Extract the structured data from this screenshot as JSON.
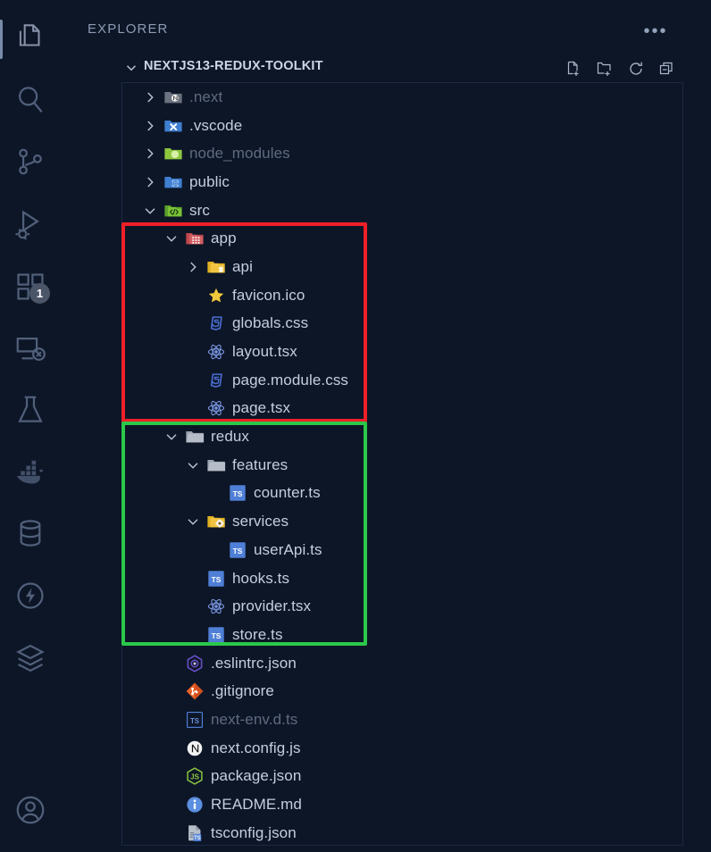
{
  "window": {
    "background": "#0d1627",
    "panel_border": "#1b2a42"
  },
  "activity_bar": {
    "items": [
      {
        "name": "explorer",
        "icon": "files-icon",
        "active": true,
        "badge": null
      },
      {
        "name": "search",
        "icon": "search-icon",
        "active": false,
        "badge": null
      },
      {
        "name": "source-control",
        "icon": "source-control-icon",
        "active": false,
        "badge": null
      },
      {
        "name": "run-and-debug",
        "icon": "run-debug-icon",
        "active": false,
        "badge": null
      },
      {
        "name": "extensions",
        "icon": "extensions-icon",
        "active": false,
        "badge": "1"
      },
      {
        "name": "remote-explorer",
        "icon": "remote-explorer-icon",
        "active": false,
        "badge": null
      },
      {
        "name": "testing",
        "icon": "beaker-icon",
        "active": false,
        "badge": null
      },
      {
        "name": "docker",
        "icon": "docker-icon",
        "active": false,
        "badge": null
      },
      {
        "name": "database",
        "icon": "database-icon",
        "active": false,
        "badge": null
      },
      {
        "name": "thunder-client",
        "icon": "thunder-icon",
        "active": false,
        "badge": null
      },
      {
        "name": "layers",
        "icon": "layers-icon",
        "active": false,
        "badge": null
      },
      {
        "name": "accounts",
        "icon": "account-icon",
        "active": false,
        "badge": null
      }
    ]
  },
  "sidebar": {
    "title": "EXPLORER",
    "more_actions_label": "•••",
    "root": {
      "label": "NEXTJS13-REDUX-TOOLKIT",
      "expanded": true,
      "toolbar": [
        {
          "name": "new-file-button",
          "icon": "new-file-icon"
        },
        {
          "name": "new-folder-button",
          "icon": "new-folder-icon"
        },
        {
          "name": "refresh-explorer-button",
          "icon": "refresh-icon"
        },
        {
          "name": "collapse-folders-button",
          "icon": "collapse-all-icon"
        }
      ]
    }
  },
  "tree": {
    "row_height": 31.7,
    "indent": 24,
    "items": [
      {
        "label": ".next",
        "type": "folder",
        "icon": "folder-next-icon",
        "depth": 0,
        "state": "collapsed",
        "dim": true
      },
      {
        "label": ".vscode",
        "type": "folder",
        "icon": "folder-vscode-icon",
        "depth": 0,
        "state": "collapsed",
        "dim": false
      },
      {
        "label": "node_modules",
        "type": "folder",
        "icon": "folder-node-icon",
        "depth": 0,
        "state": "collapsed",
        "dim": true
      },
      {
        "label": "public",
        "type": "folder",
        "icon": "folder-public-icon",
        "depth": 0,
        "state": "collapsed",
        "dim": false
      },
      {
        "label": "src",
        "type": "folder",
        "icon": "folder-src-icon",
        "depth": 0,
        "state": "expanded",
        "dim": false
      },
      {
        "label": "app",
        "type": "folder",
        "icon": "folder-app-icon",
        "depth": 1,
        "state": "expanded",
        "dim": false
      },
      {
        "label": "api",
        "type": "folder",
        "icon": "folder-api-icon",
        "depth": 2,
        "state": "collapsed",
        "dim": false
      },
      {
        "label": "favicon.ico",
        "type": "file",
        "icon": "favicon-star-icon",
        "depth": 2,
        "state": "none",
        "dim": false
      },
      {
        "label": "globals.css",
        "type": "file",
        "icon": "css-icon",
        "depth": 2,
        "state": "none",
        "dim": false
      },
      {
        "label": "layout.tsx",
        "type": "file",
        "icon": "react-icon",
        "depth": 2,
        "state": "none",
        "dim": false
      },
      {
        "label": "page.module.css",
        "type": "file",
        "icon": "css-icon",
        "depth": 2,
        "state": "none",
        "dim": false
      },
      {
        "label": "page.tsx",
        "type": "file",
        "icon": "react-icon",
        "depth": 2,
        "state": "none",
        "dim": false
      },
      {
        "label": "redux",
        "type": "folder",
        "icon": "folder-plain-icon",
        "depth": 1,
        "state": "expanded",
        "dim": false
      },
      {
        "label": "features",
        "type": "folder",
        "icon": "folder-plain-icon",
        "depth": 2,
        "state": "expanded",
        "dim": false
      },
      {
        "label": "counter.ts",
        "type": "file",
        "icon": "typescript-icon",
        "depth": 3,
        "state": "none",
        "dim": false
      },
      {
        "label": "services",
        "type": "folder",
        "icon": "folder-services-icon",
        "depth": 2,
        "state": "expanded",
        "dim": false
      },
      {
        "label": "userApi.ts",
        "type": "file",
        "icon": "typescript-icon",
        "depth": 3,
        "state": "none",
        "dim": false
      },
      {
        "label": "hooks.ts",
        "type": "file",
        "icon": "typescript-icon",
        "depth": 2,
        "state": "none",
        "dim": false
      },
      {
        "label": "provider.tsx",
        "type": "file",
        "icon": "react-icon",
        "depth": 2,
        "state": "none",
        "dim": false
      },
      {
        "label": "store.ts",
        "type": "file",
        "icon": "typescript-icon",
        "depth": 2,
        "state": "none",
        "dim": false
      },
      {
        "label": ".eslintrc.json",
        "type": "file",
        "icon": "eslint-icon",
        "depth": 1,
        "state": "none",
        "dim": false
      },
      {
        "label": ".gitignore",
        "type": "file",
        "icon": "git-icon",
        "depth": 1,
        "state": "none",
        "dim": false
      },
      {
        "label": "next-env.d.ts",
        "type": "file",
        "icon": "typescript-def-icon",
        "depth": 1,
        "state": "none",
        "dim": true
      },
      {
        "label": "next.config.js",
        "type": "file",
        "icon": "nextjs-icon",
        "depth": 1,
        "state": "none",
        "dim": false
      },
      {
        "label": "package.json",
        "type": "file",
        "icon": "nodejs-icon",
        "depth": 1,
        "state": "none",
        "dim": false
      },
      {
        "label": "README.md",
        "type": "file",
        "icon": "info-icon",
        "depth": 1,
        "state": "none",
        "dim": false
      },
      {
        "label": "tsconfig.json",
        "type": "file",
        "icon": "tsconfig-icon",
        "depth": 1,
        "state": "none",
        "dim": false
      }
    ]
  },
  "annotations": [
    {
      "name": "app-folder-highlight",
      "color": "#f01f28",
      "covers": [
        "app",
        "api",
        "favicon.ico",
        "globals.css",
        "layout.tsx",
        "page.module.css",
        "page.tsx"
      ]
    },
    {
      "name": "redux-folder-highlight",
      "color": "#2bc84a",
      "covers": [
        "redux",
        "features",
        "counter.ts",
        "services",
        "userApi.ts",
        "hooks.ts",
        "provider.tsx",
        "store.ts"
      ]
    }
  ]
}
